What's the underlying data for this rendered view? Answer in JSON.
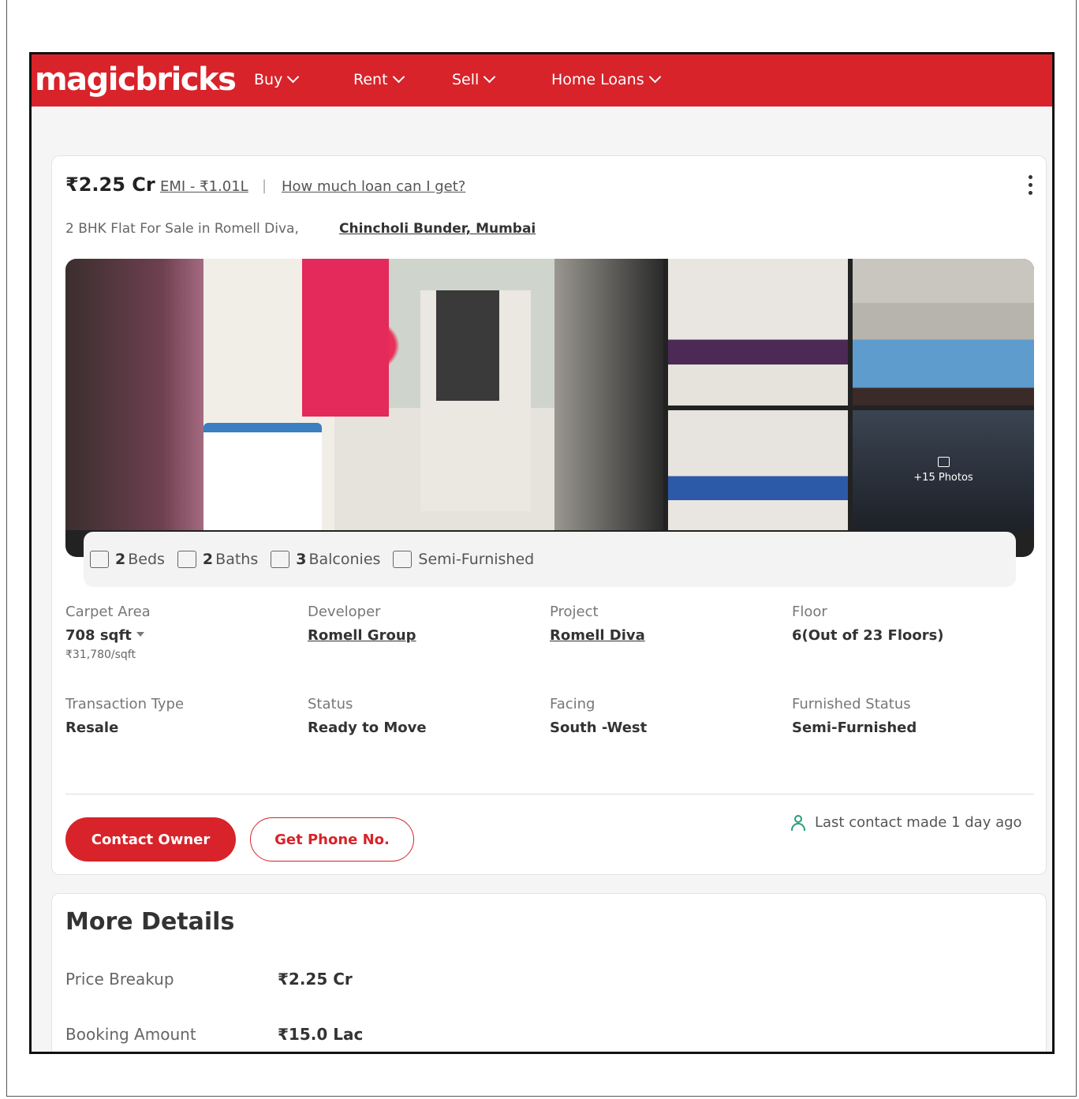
{
  "nav": {
    "logo": "magicbricks",
    "items": [
      {
        "label": "Buy"
      },
      {
        "label": "Rent"
      },
      {
        "label": "Sell"
      },
      {
        "label": "Home Loans"
      }
    ]
  },
  "listing": {
    "price": "₹2.25 Cr",
    "emi": "EMI - ₹1.01L",
    "separator": "|",
    "loan_link": "How much loan can I get?",
    "title": "2 BHK Flat For Sale in Romell Diva,",
    "locality": "Chincholi Bunder, Mumbai",
    "more_photos": "+15 Photos",
    "features": [
      {
        "count": "2",
        "label": "Beds",
        "icon": "bed-icon"
      },
      {
        "count": "2",
        "label": "Baths",
        "icon": "bath-icon"
      },
      {
        "count": "3",
        "label": "Balconies",
        "icon": "balcony-icon"
      },
      {
        "count": "",
        "label": "Semi-Furnished",
        "icon": "furnished-icon"
      }
    ],
    "details": [
      {
        "label": "Carpet Area",
        "value": "708 sqft",
        "sub": "₹31,780/sqft"
      },
      {
        "label": "Developer",
        "value": "Romell Group"
      },
      {
        "label": "Project",
        "value": "Romell Diva"
      },
      {
        "label": "Floor",
        "value": "6(Out of 23 Floors)"
      },
      {
        "label": "Transaction Type",
        "value": "Resale"
      },
      {
        "label": "Status",
        "value": "Ready to Move"
      },
      {
        "label": "Facing",
        "value": "South -West"
      },
      {
        "label": "Furnished Status",
        "value": "Semi-Furnished"
      }
    ],
    "contact_button": "Contact Owner",
    "phone_button": "Get Phone No.",
    "last_contact": "Last contact made 1 day ago"
  },
  "more_details": {
    "title": "More Details",
    "rows": [
      {
        "label": "Price Breakup",
        "value": "₹2.25 Cr"
      },
      {
        "label": "Booking Amount",
        "value": "₹15.0 Lac"
      }
    ]
  },
  "colors": {
    "brand": "#d8232a",
    "accent_green": "#2a9d7d"
  }
}
